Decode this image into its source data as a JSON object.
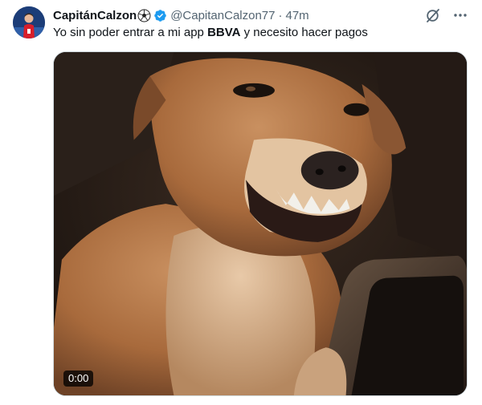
{
  "tweet": {
    "display_name": "CapitánCalzon",
    "name_emoji": "soccer-ball-icon",
    "verified_icon": "verified-badge-icon",
    "handle": "@CapitanCalzon77",
    "separator": "·",
    "time": "47m",
    "text_before": "Yo sin poder entrar a mi app ",
    "text_bold": "BBVA",
    "text_after": " y necesito hacer pagos",
    "colors": {
      "verified": "#1d9bf0",
      "secondary_text": "#536471",
      "primary_text": "#0f1419"
    }
  },
  "actions": {
    "grok_icon": "grok-slash-icon",
    "more_icon": "more-dots-icon"
  },
  "media": {
    "type": "video",
    "duration": "0:00",
    "subject_icon": "grinning-dog-holding-phone"
  }
}
